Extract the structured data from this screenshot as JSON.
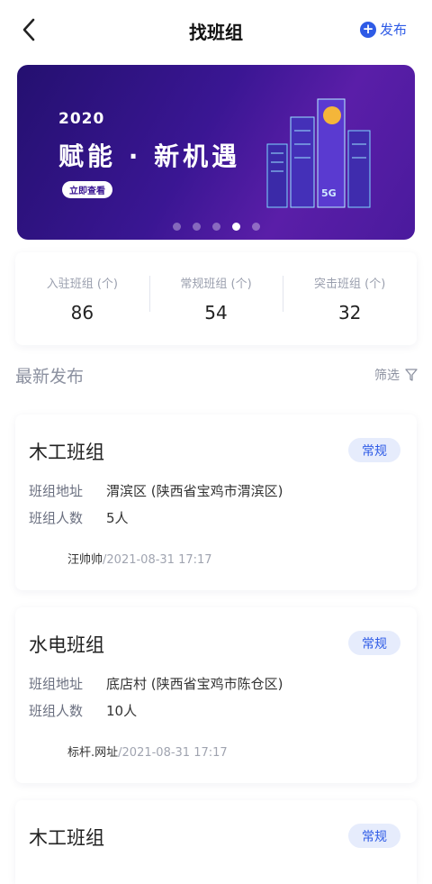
{
  "header": {
    "title": "找班组",
    "publish_label": "发布"
  },
  "banner": {
    "year": "2020",
    "slogan": "赋能 · 新机遇",
    "cta": "立即查看",
    "badge": "5G",
    "dots": 5,
    "active_dot": 4
  },
  "stats": [
    {
      "label": "入驻班组 (个)",
      "value": "86"
    },
    {
      "label": "常规班组 (个)",
      "value": "54"
    },
    {
      "label": "突击班组 (个)",
      "value": "32"
    }
  ],
  "section": {
    "title": "最新发布",
    "filter_label": "筛选"
  },
  "labels": {
    "address": "班组地址",
    "count": "班组人数"
  },
  "cards": [
    {
      "name": "木工班组",
      "tag": "常规",
      "address": "渭滨区 (陕西省宝鸡市渭滨区)",
      "count": "5人",
      "author": "汪帅帅",
      "time": "/2021-08-31 17:17"
    },
    {
      "name": "水电班组",
      "tag": "常规",
      "address": "底店村 (陕西省宝鸡市陈仓区)",
      "count": "10人",
      "author": "标杆.网址",
      "time": "/2021-08-31 17:17"
    },
    {
      "name": "木工班组",
      "tag": "常规"
    }
  ]
}
